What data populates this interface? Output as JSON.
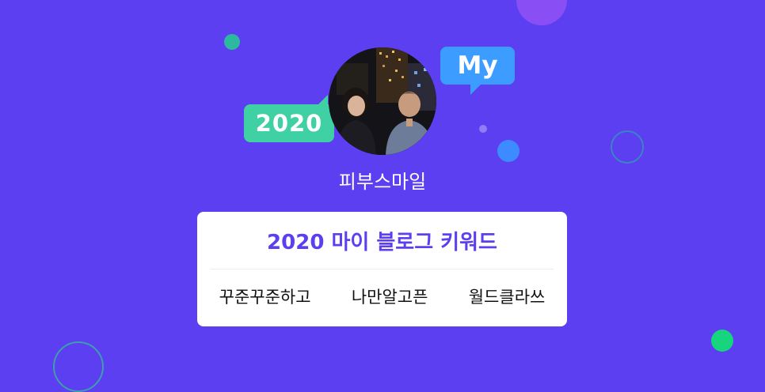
{
  "profile": {
    "name": "피부스마일",
    "avatar_alt": "profile photo"
  },
  "bubbles": {
    "year_label": "2020",
    "my_label": "My",
    "year_color": "#3fd0a3",
    "my_color": "#3d9cff"
  },
  "keyword_card": {
    "title": "2020 마이 블로그 키워드",
    "keywords": [
      "꾸준꾸준하고",
      "나만알고픈",
      "월드클라쓰"
    ]
  },
  "colors": {
    "background": "#5b3ff0",
    "accent": "#5b3ff0",
    "card": "#ffffff"
  }
}
